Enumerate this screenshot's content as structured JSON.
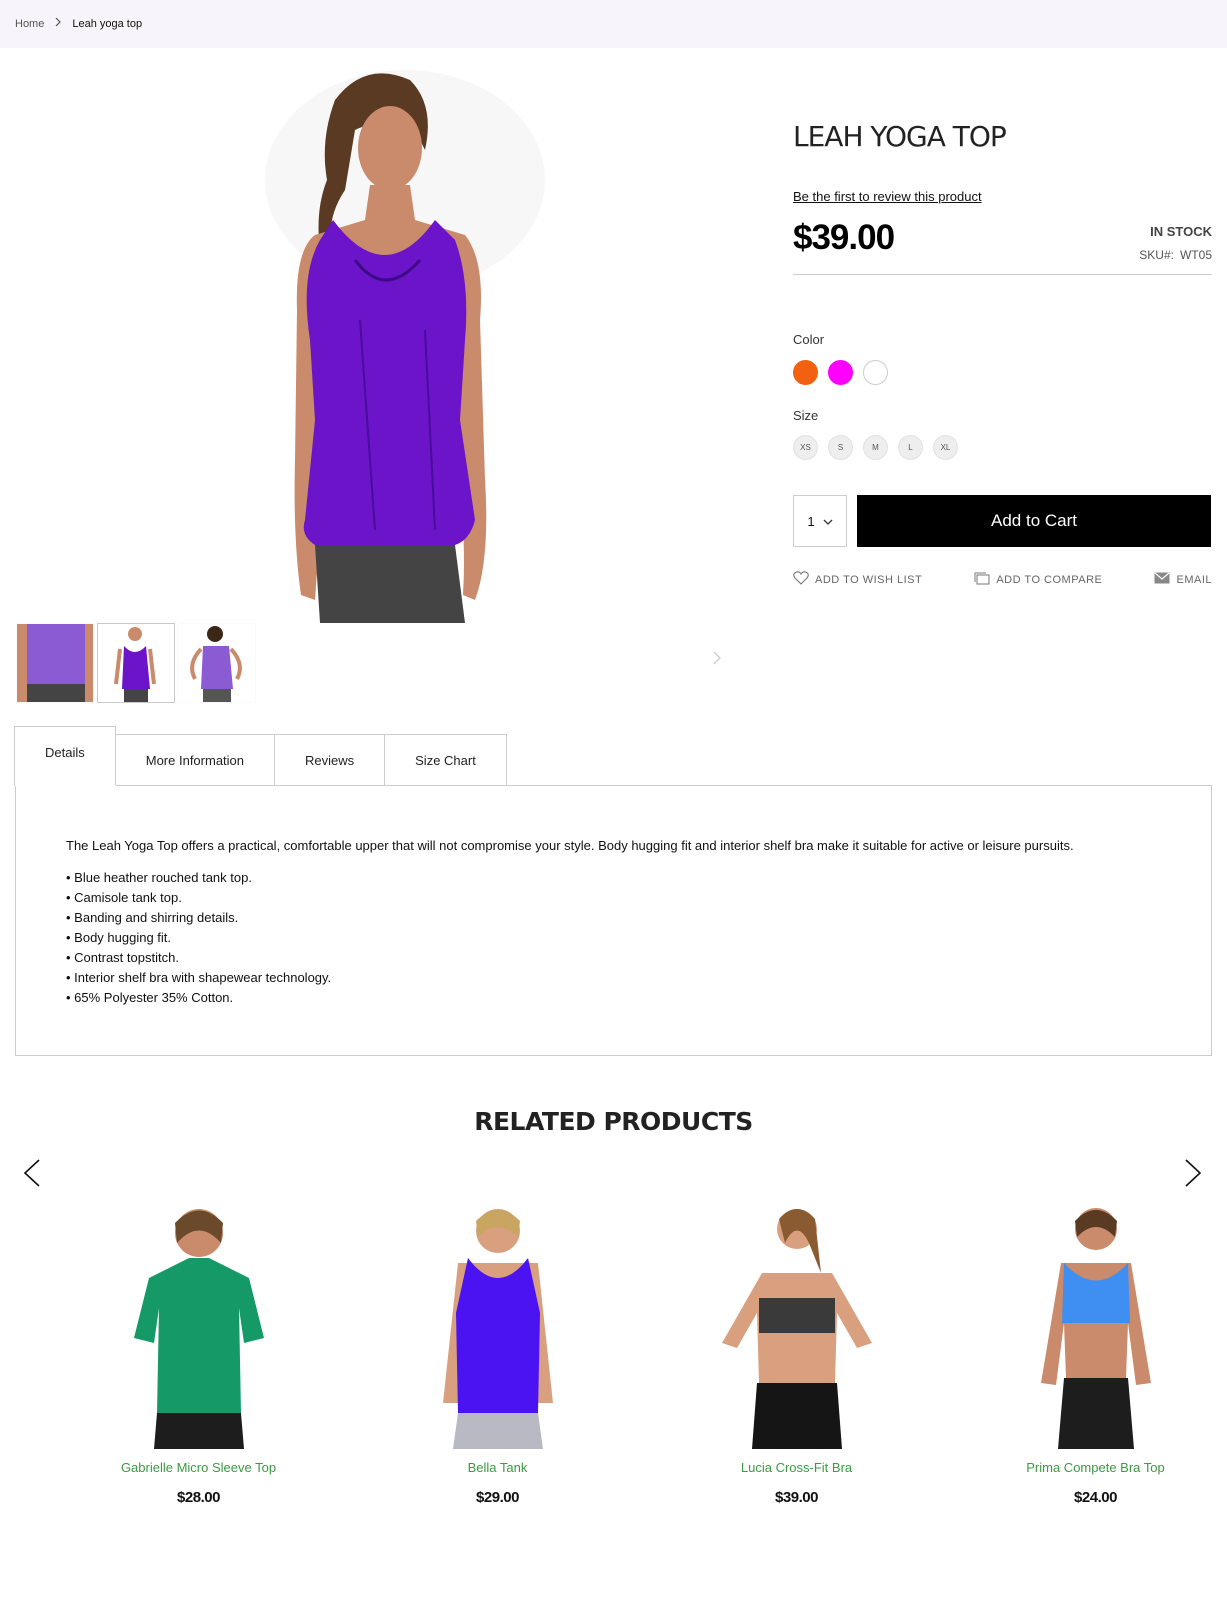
{
  "breadcrumb": {
    "home": "Home",
    "current": "Leah yoga top"
  },
  "product": {
    "title": "LEAH YOGA TOP",
    "review_link": "Be the first to review this product",
    "price": "$39.00",
    "stock": "IN STOCK",
    "sku_label": "SKU#:",
    "sku": "WT05",
    "color_label": "Color",
    "colors": [
      "#f26011",
      "#ff00ff",
      "#ffffff"
    ],
    "size_label": "Size",
    "sizes": [
      "XS",
      "S",
      "M",
      "L",
      "XL"
    ],
    "qty": "1",
    "add_to_cart": "Add to Cart",
    "actions": {
      "wishlist": "ADD TO WISH LIST",
      "compare": "ADD TO COMPARE",
      "email": "EMAIL"
    }
  },
  "tabs": [
    "Details",
    "More Information",
    "Reviews",
    "Size Chart"
  ],
  "details": {
    "description": "The Leah Yoga Top offers a practical, comfortable upper that will not compromise your style. Body hugging fit and interior shelf bra make it suitable for active or leisure pursuits.",
    "features": [
      "• Blue heather rouched tank top.",
      "• Camisole tank top.",
      "• Banding and shirring details.",
      "• Body hugging fit.",
      "• Contrast topstitch.",
      "• Interior shelf bra with shapewear technology.",
      "• 65% Polyester 35% Cotton."
    ]
  },
  "related": {
    "title": "RELATED PRODUCTS",
    "items": [
      {
        "name": "Gabrielle Micro Sleeve Top",
        "price": "$28.00",
        "color": "#159a67"
      },
      {
        "name": "Bella Tank",
        "price": "$29.00",
        "color": "#4b12f2"
      },
      {
        "name": "Lucia Cross-Fit Bra",
        "price": "$39.00",
        "color": "#3a3a3a"
      },
      {
        "name": "Prima Compete Bra Top",
        "price": "$24.00",
        "color": "#3f8ef2"
      }
    ]
  },
  "colors": {
    "accent": "#000000",
    "link_green": "#3c9a45",
    "breadcrumb_bg": "#f8f4fb",
    "garment": "#6b14c9"
  }
}
